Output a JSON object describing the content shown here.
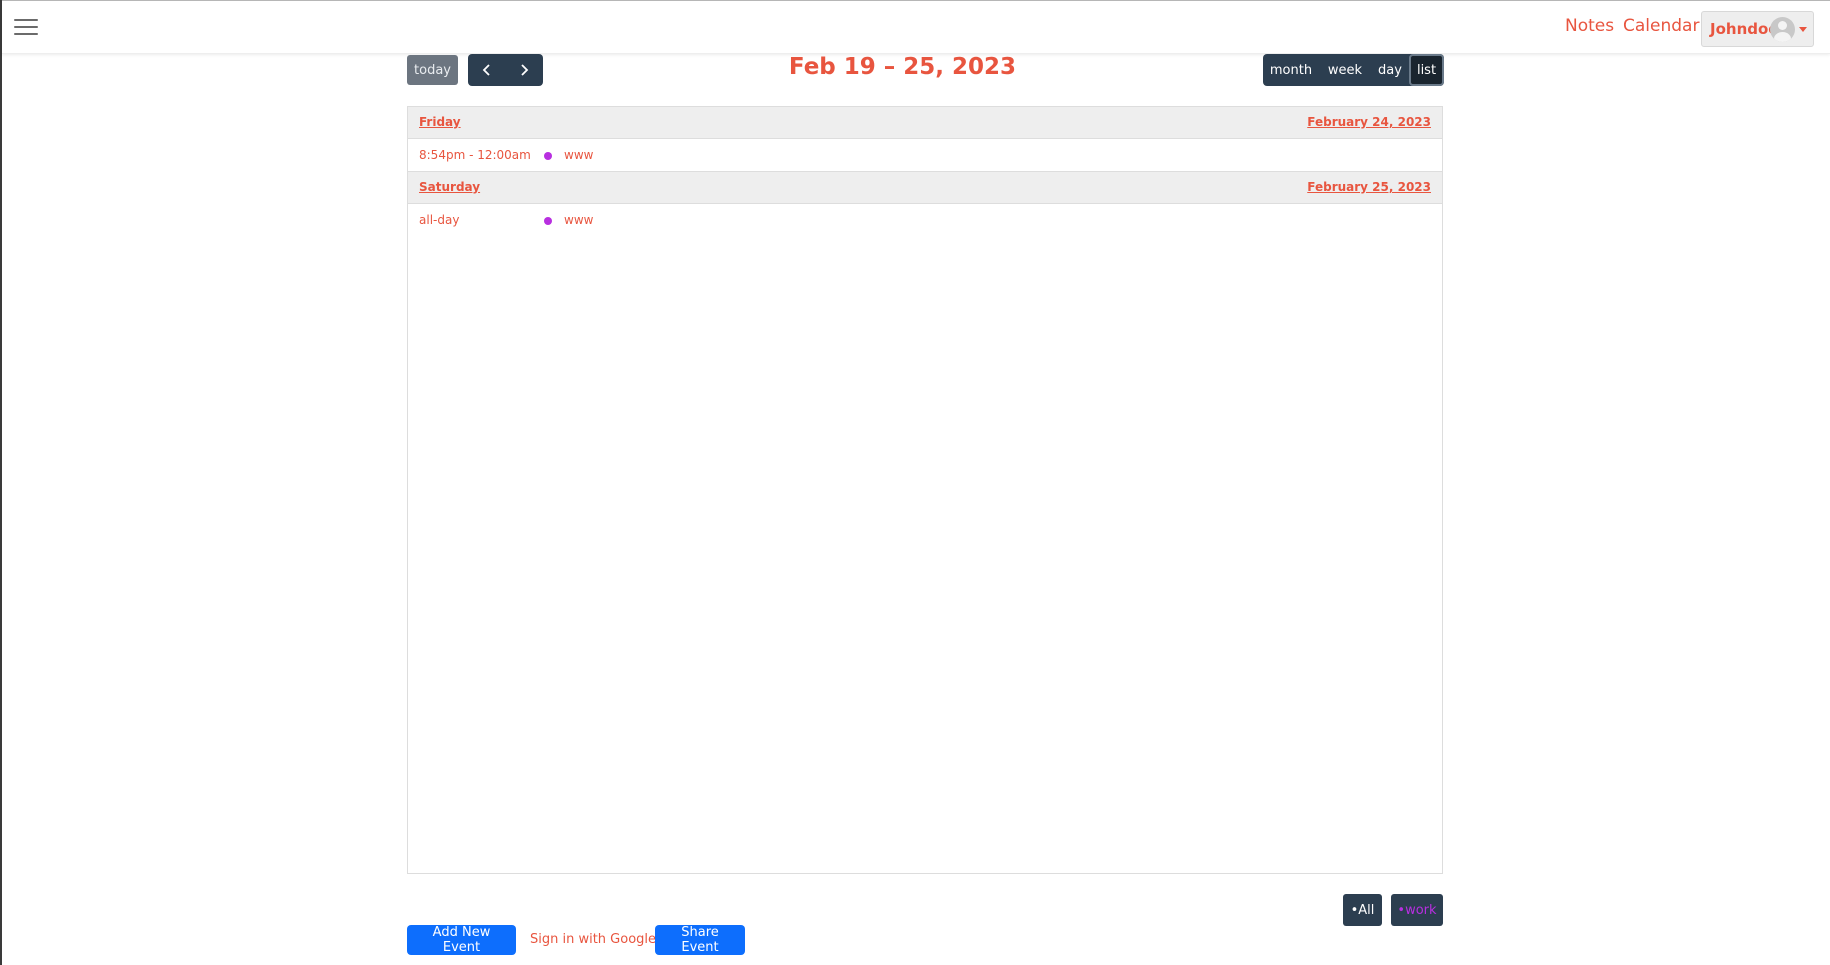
{
  "navbar": {
    "notes_label": "Notes",
    "calendar_label": "Calendar",
    "user_name": "Johndoe"
  },
  "toolbar": {
    "today_label": "today",
    "title": "Feb 19 – 25, 2023",
    "views": {
      "month": "month",
      "week": "week",
      "day": "day",
      "list": "list"
    },
    "active_view": "list"
  },
  "list": {
    "days": [
      {
        "day_name": "Friday",
        "date_label": "February 24, 2023",
        "events": [
          {
            "time": "8:54pm - 12:00am",
            "title": "www",
            "color": "#b82fe0"
          }
        ]
      },
      {
        "day_name": "Saturday",
        "date_label": "February 25, 2023",
        "events": [
          {
            "time": "all-day",
            "title": "www",
            "color": "#b82fe0"
          }
        ]
      }
    ]
  },
  "filters": {
    "all_label": "•All",
    "work_label": "•work",
    "work_color": "#b82fe0"
  },
  "actions": {
    "add_label": "Add New Event",
    "google_label": "Sign in with Google",
    "share_label": "Share Event"
  },
  "colors": {
    "accent": "#e8553f",
    "dark": "#2c3e50",
    "primary": "#0d6efd"
  }
}
